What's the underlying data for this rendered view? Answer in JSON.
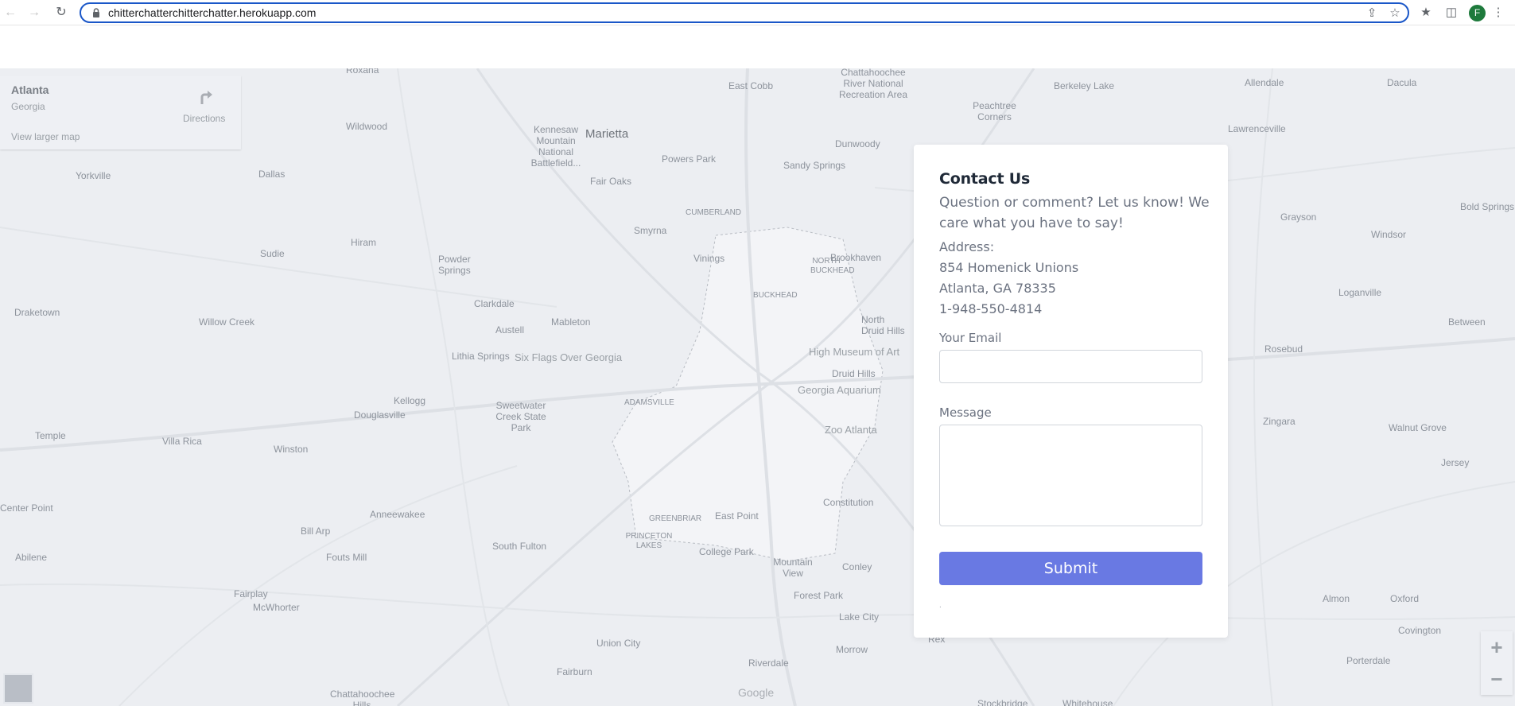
{
  "browser": {
    "url": "chitterchatterchitterchatter.herokuapp.com",
    "avatar_initial": "F",
    "icons": [
      "back-arrow-icon",
      "forward-arrow-icon",
      "reload-icon",
      "lock-icon",
      "share-icon",
      "bookmark-star-icon",
      "extensions-icon",
      "side-panel-icon",
      "menu-kebab-icon"
    ]
  },
  "map": {
    "info": {
      "city": "Atlanta",
      "state": "Georgia",
      "larger_map": "View larger map",
      "directions": "Directions"
    },
    "places": [
      {
        "name": "Roxana"
      },
      {
        "name": "East Cobb"
      },
      {
        "name": "Chattahoochee River National Recreation Area"
      },
      {
        "name": "Berkeley Lake"
      },
      {
        "name": "Allendale"
      },
      {
        "name": "Dacula"
      },
      {
        "name": "Peachtree Corners"
      },
      {
        "name": "Wildwood"
      },
      {
        "name": "Kennesaw Mountain National Battlefield..."
      },
      {
        "name": "Marietta"
      },
      {
        "name": "Powers Park"
      },
      {
        "name": "Dunwoody"
      },
      {
        "name": "Lawrenceville"
      },
      {
        "name": "Yorkville"
      },
      {
        "name": "Dallas"
      },
      {
        "name": "Fair Oaks"
      },
      {
        "name": "Sandy Springs"
      },
      {
        "name": "CUMBERLAND"
      },
      {
        "name": "Smyrna"
      },
      {
        "name": "Grayson"
      },
      {
        "name": "Bold Springs"
      },
      {
        "name": "Hiram"
      },
      {
        "name": "Sudie"
      },
      {
        "name": "Vinings"
      },
      {
        "name": "Brookhaven"
      },
      {
        "name": "Windsor"
      },
      {
        "name": "Powder Springs"
      },
      {
        "name": "BUCKHEAD"
      },
      {
        "name": "NORTH BUCKHEAD"
      },
      {
        "name": "Loganville"
      },
      {
        "name": "Draketown"
      },
      {
        "name": "Clarkdale"
      },
      {
        "name": "Willow Creek"
      },
      {
        "name": "Mableton"
      },
      {
        "name": "Austell"
      },
      {
        "name": "North Druid Hills"
      },
      {
        "name": "Rosebud"
      },
      {
        "name": "Between"
      },
      {
        "name": "Lithia Springs"
      },
      {
        "name": "Six Flags Over Georgia"
      },
      {
        "name": "High Museum of Art"
      },
      {
        "name": "Druid Hills"
      },
      {
        "name": "Georgia Aquarium"
      },
      {
        "name": "Kellogg"
      },
      {
        "name": "Douglasville"
      },
      {
        "name": "Sweetwater Creek State Park"
      },
      {
        "name": "ADAMSVILLE"
      },
      {
        "name": "Zoo Atlanta"
      },
      {
        "name": "Zingara"
      },
      {
        "name": "Walnut Grove"
      },
      {
        "name": "Temple"
      },
      {
        "name": "Villa Rica"
      },
      {
        "name": "Winston"
      },
      {
        "name": "Jersey"
      },
      {
        "name": "Center Point"
      },
      {
        "name": "Anneewakee"
      },
      {
        "name": "Constitution"
      },
      {
        "name": "GREENBRIAR"
      },
      {
        "name": "East Point"
      },
      {
        "name": "Bill Arp"
      },
      {
        "name": "South Fulton"
      },
      {
        "name": "PRINCETON LAKES"
      },
      {
        "name": "College Park"
      },
      {
        "name": "Mountain View"
      },
      {
        "name": "Conley"
      },
      {
        "name": "Abilene"
      },
      {
        "name": "Fouts Mill"
      },
      {
        "name": "Fairplay"
      },
      {
        "name": "McWhorter"
      },
      {
        "name": "Forest Park"
      },
      {
        "name": "Lake City"
      },
      {
        "name": "Almon"
      },
      {
        "name": "Oxford"
      },
      {
        "name": "Covington"
      },
      {
        "name": "Union City"
      },
      {
        "name": "Morrow"
      },
      {
        "name": "Porterdale"
      },
      {
        "name": "Fairburn"
      },
      {
        "name": "Riverdale"
      },
      {
        "name": "Chattahoochee Hills"
      },
      {
        "name": "Rex"
      },
      {
        "name": "Stockbridge"
      },
      {
        "name": "Whitehouse"
      }
    ],
    "google_label": "Google",
    "zoom_in": "+",
    "zoom_out": "−"
  },
  "contact": {
    "title": "Contact Us",
    "lead": "Question or comment? Let us know! We care what you have to say!",
    "address_label": "Address:",
    "address_line1": "854 Homenick Unions",
    "address_line2": "Atlanta, GA 78335",
    "phone": "1-948-550-4814",
    "email_label": "Your Email",
    "email_value": "",
    "message_label": "Message",
    "message_value": "",
    "submit_label": "Submit",
    "fineprint": "."
  }
}
